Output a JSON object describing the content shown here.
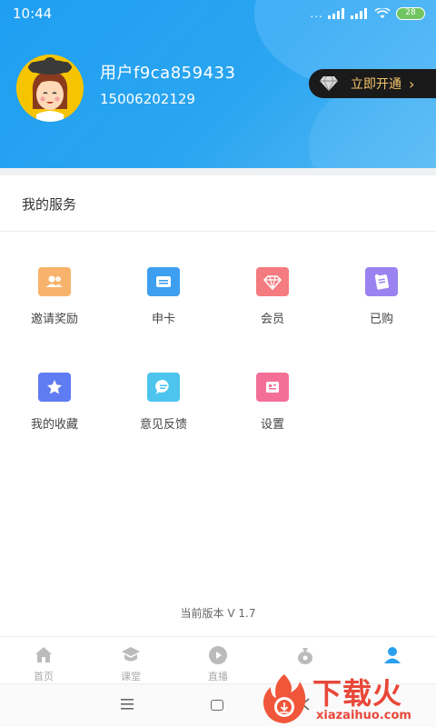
{
  "status_bar": {
    "time": "10:44",
    "signal_dots": "...",
    "battery": "28"
  },
  "profile": {
    "username": "用户f9ca859433",
    "phone": "15006202129",
    "vip_button_label": "立即开通",
    "vip_arrow": "›"
  },
  "services": {
    "title": "我的服务",
    "items": [
      {
        "label": "邀请奖励",
        "icon": "invite-users-icon",
        "color": "#f7b36b"
      },
      {
        "label": "申卡",
        "icon": "card-icon",
        "color": "#3e9ff0"
      },
      {
        "label": "会员",
        "icon": "diamond-icon",
        "color": "#f47b80"
      },
      {
        "label": "已购",
        "icon": "purchased-icon",
        "color": "#9a82f0"
      },
      {
        "label": "我的收藏",
        "icon": "star-icon",
        "color": "#5f7cf2"
      },
      {
        "label": "意见反馈",
        "icon": "chat-bubble-icon",
        "color": "#4cc4ee"
      },
      {
        "label": "设置",
        "icon": "settings-icon",
        "color": "#f46f98"
      }
    ]
  },
  "version_text": "当前版本 V 1.7",
  "tab_bar": {
    "tabs": [
      {
        "label": "首页",
        "icon": "home-icon",
        "active": false
      },
      {
        "label": "课堂",
        "icon": "classroom-icon",
        "active": false
      },
      {
        "label": "直播",
        "icon": "play-icon",
        "active": false
      },
      {
        "label": "",
        "icon": "money-bag-icon",
        "active": false
      },
      {
        "label": "",
        "icon": "profile-icon",
        "active": true
      }
    ],
    "active_color": "#2a9ff0",
    "inactive_color": "#bbbbbb"
  },
  "watermark": {
    "title": "下载火",
    "url": "xiazaihuo.com"
  },
  "colors": {
    "header_blue": "#1f9ff2",
    "vip_gold": "#f5c46d"
  }
}
